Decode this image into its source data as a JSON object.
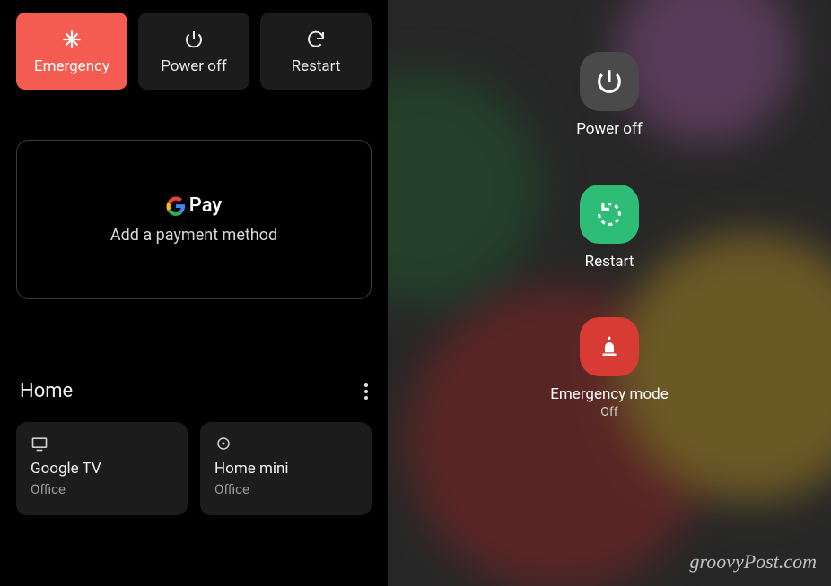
{
  "left": {
    "top_buttons": {
      "emergency": "Emergency",
      "power_off": "Power off",
      "restart": "Restart"
    },
    "pay": {
      "brand": "Pay",
      "subtitle": "Add a payment method"
    },
    "home": {
      "title": "Home"
    },
    "devices": [
      {
        "icon": "tv-icon",
        "name": "Google TV",
        "location": "Office"
      },
      {
        "icon": "speaker-icon",
        "name": "Home mini",
        "location": "Office"
      }
    ]
  },
  "right": {
    "items": {
      "power_off": {
        "label": "Power off"
      },
      "restart": {
        "label": "Restart"
      },
      "emergency": {
        "label": "Emergency mode",
        "sub": "Off"
      }
    },
    "watermark": "groovyPost.com"
  },
  "colors": {
    "emergency_bg": "#f45c52",
    "restart_green": "#2ebd77",
    "emg_red": "#d83a34"
  }
}
